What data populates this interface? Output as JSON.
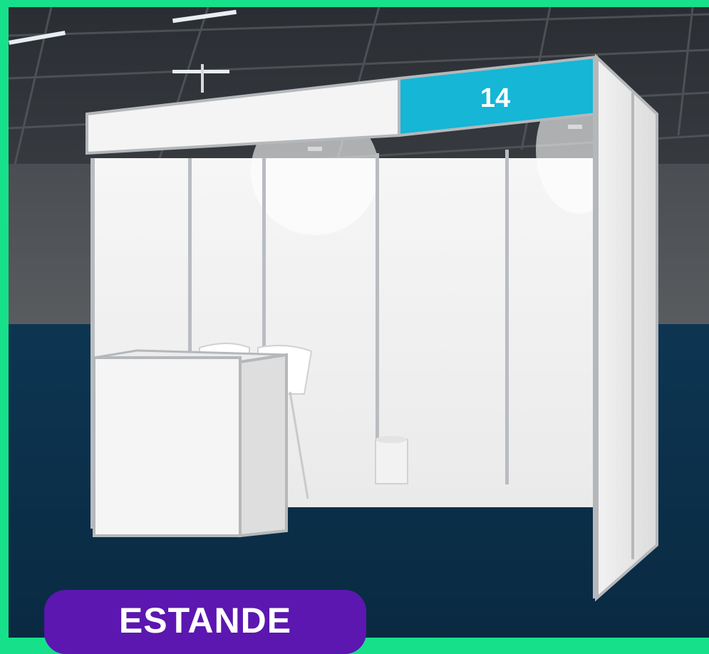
{
  "booth": {
    "number": "14",
    "sign_color": "#15b6d6",
    "frame_color": "#17e08a",
    "carpet_color": "#0c3350"
  },
  "badge": {
    "label": "ESTANDE",
    "color": "#5b17b0"
  },
  "icons": [
    "ceiling-light-icon",
    "spotlight-icon"
  ]
}
